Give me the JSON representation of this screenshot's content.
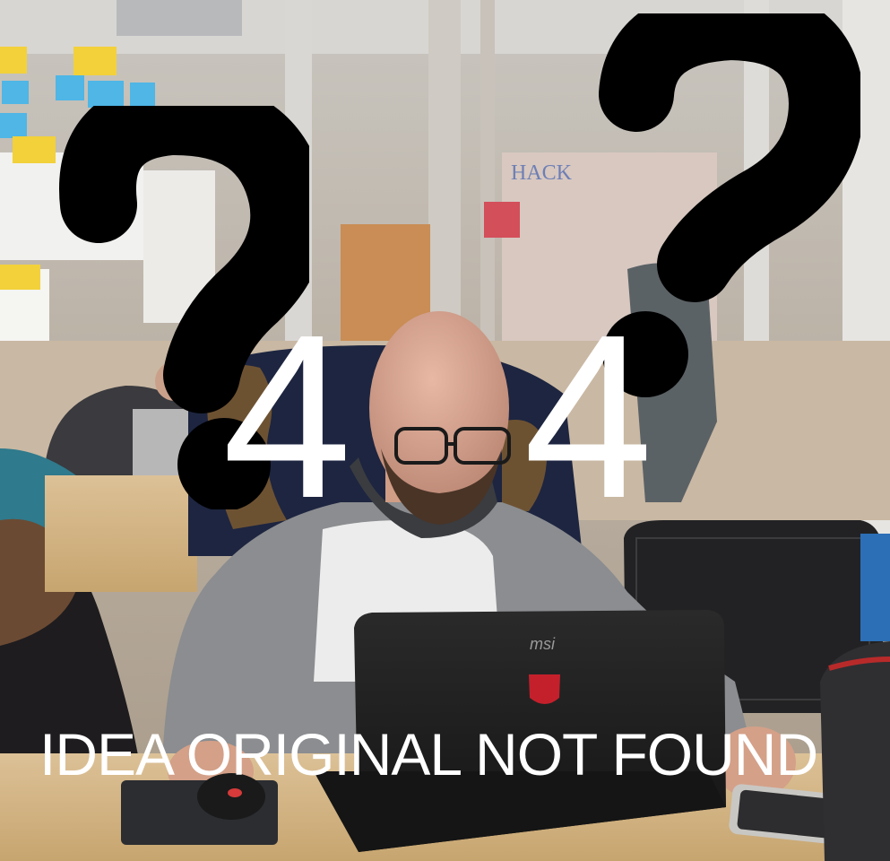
{
  "overlay": {
    "digit_left": "4",
    "digit_right": "4",
    "caption": "IDEA ORIGINAL NOT FOUND"
  },
  "photo": {
    "wall_signage": "HACK",
    "laptop_brand": "msi"
  },
  "icons": {
    "left_question_mark": "question-mark-icon",
    "right_question_mark": "question-mark-icon"
  },
  "colors": {
    "overlay_text": "#ffffff",
    "question_marks": "#000000",
    "wood_desk": "#d7b889",
    "hoodie": "#8b8d90"
  }
}
